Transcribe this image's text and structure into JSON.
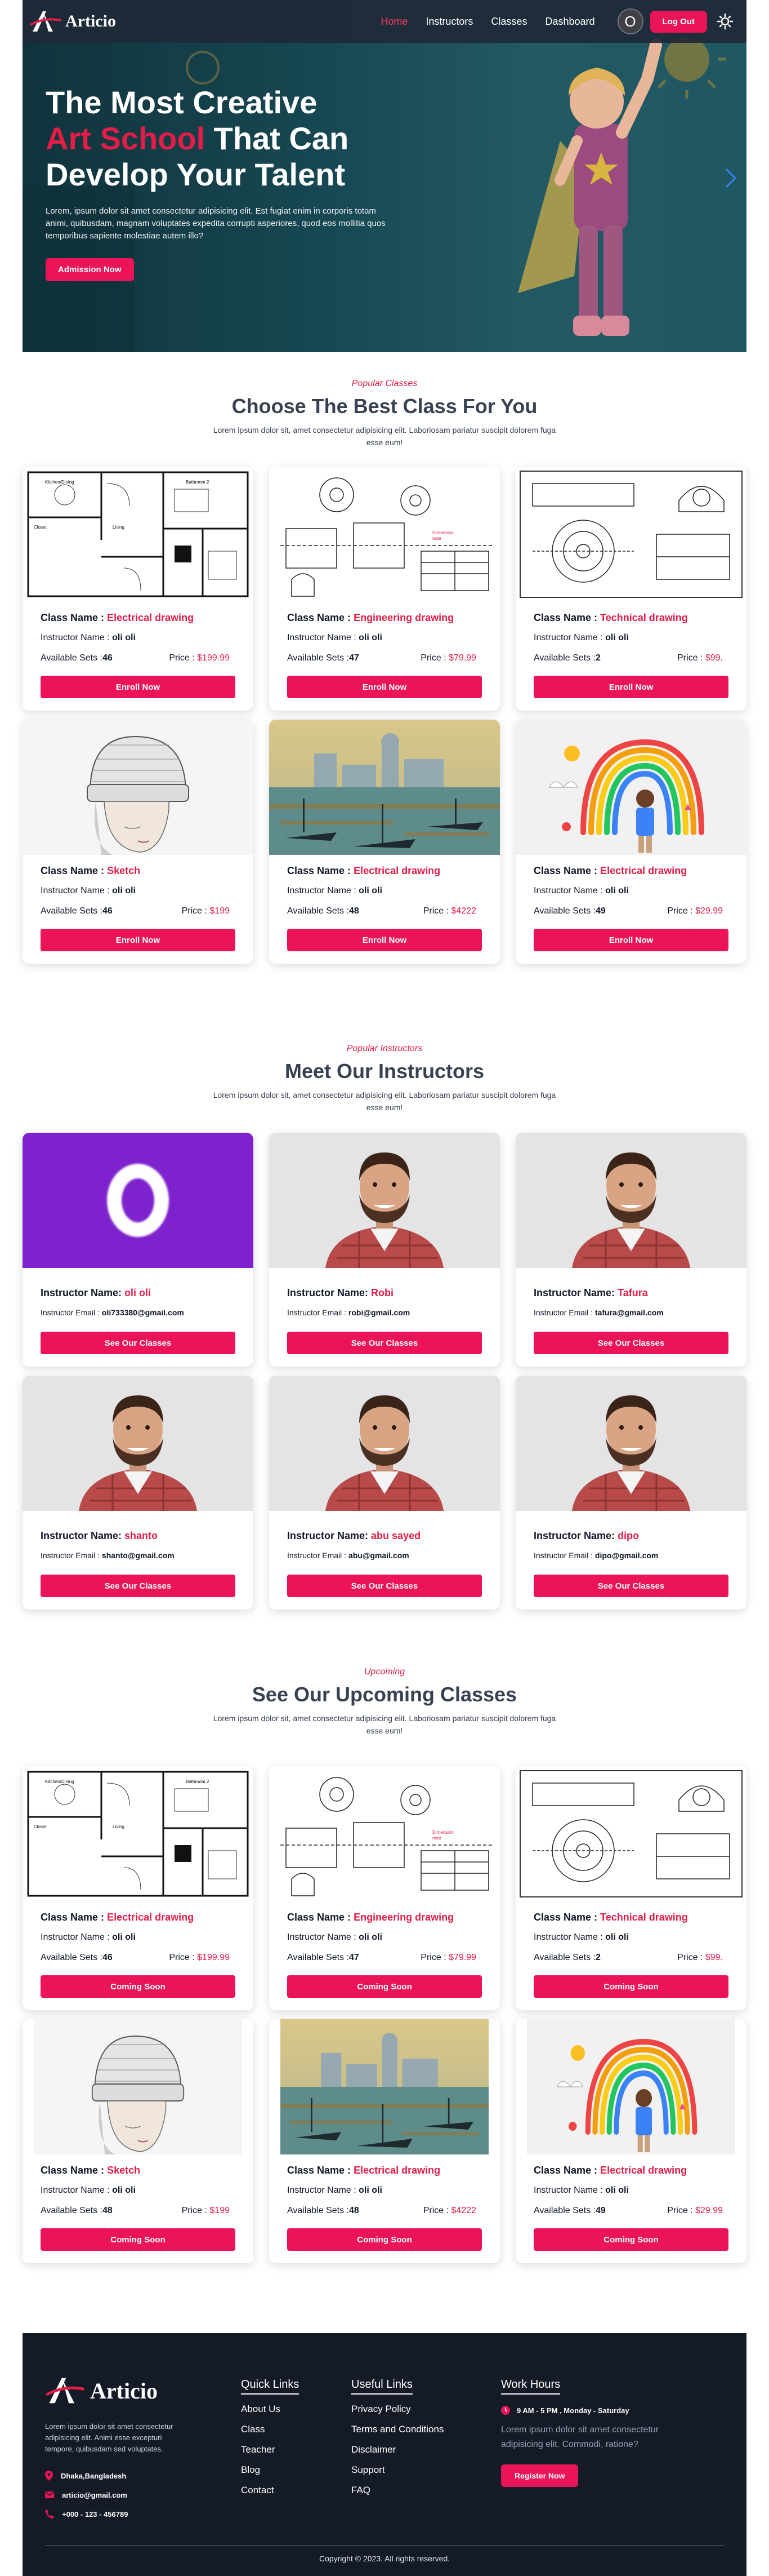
{
  "brand": {
    "name": "Articio"
  },
  "nav": {
    "links": [
      "Home",
      "Instructors",
      "Classes",
      "Dashboard"
    ],
    "avatar_letter": "O",
    "logout_label": "Log Out"
  },
  "hero": {
    "title_line1": "The Most Creative",
    "title_accent": "Art School",
    "title_line2_rest": " That Can",
    "title_line3": "Develop Your Talent",
    "description": "Lorem, ipsum dolor sit amet consectetur adipisicing elit. Est fugiat enim in corporis totam animi, quibusdam, magnam voluptates expedita corrupti asperiores, quod eos mollitia quos temporibus sapiente molestiae autem illo?",
    "button_label": "Admission Now"
  },
  "popular_classes": {
    "subtitle": "Popular Classes",
    "title": "Choose The Best Class For You",
    "description": "Lorem ipsum dolor sit, amet consectetur adipisicing elit. Laboriosam pariatur suscipit dolorem fuga esse eum!",
    "labels": {
      "class_name": "Class Name : ",
      "instructor_name": "Instructor Name : ",
      "available_sets": "Available Sets :",
      "price": "Price : "
    },
    "button_label": "Enroll Now",
    "items": [
      {
        "class_name": "Electrical drawing",
        "instructor": "oli oli",
        "sets": "46",
        "price": "$199.99",
        "image": "floor-plan"
      },
      {
        "class_name": "Engineering drawing",
        "instructor": "oli oli",
        "sets": "47",
        "price": "$79.99",
        "image": "engineering"
      },
      {
        "class_name": "Technical drawing",
        "instructor": "oli oli",
        "sets": "2",
        "price": "$99.",
        "image": "technical"
      },
      {
        "class_name": "Sketch",
        "instructor": "oli oli",
        "sets": "46",
        "price": "$199",
        "image": "sketch"
      },
      {
        "class_name": "Electrical drawing",
        "instructor": "oli oli",
        "sets": "48",
        "price": "$4222",
        "image": "painting"
      },
      {
        "class_name": "Electrical drawing",
        "instructor": "oli oli",
        "sets": "49",
        "price": "$29.99",
        "image": "rainbow"
      }
    ]
  },
  "instructors": {
    "subtitle": "Popular Instructors",
    "title": "Meet Our Instructors",
    "description": "Lorem ipsum dolor sit, amet consectetur adipisicing elit. Laboriosam pariatur suscipit dolorem fuga esse eum!",
    "labels": {
      "name": "Instructor Name: ",
      "email": "Instructor Email : "
    },
    "button_label": "See Our Classes",
    "items": [
      {
        "name": "oli oli",
        "email": "oli733380@gmail.com",
        "avatar": "letter",
        "letter": "O"
      },
      {
        "name": "Robi",
        "email": "robi@gmail.com",
        "avatar": "photo"
      },
      {
        "name": "Tafura",
        "email": "tafura@gmail.com",
        "avatar": "photo"
      },
      {
        "name": "shanto",
        "email": "shanto@gmail.com",
        "avatar": "photo"
      },
      {
        "name": "abu sayed",
        "email": "abu@gmail.com",
        "avatar": "photo"
      },
      {
        "name": "dipo",
        "email": "dipo@gmail.com",
        "avatar": "photo"
      }
    ]
  },
  "upcoming": {
    "subtitle": "Upcoming",
    "title": "See Our Upcoming Classes",
    "description": "Lorem ipsum dolor sit, amet consectetur adipisicing elit. Laboriosam pariatur suscipit dolorem fuga esse eum!",
    "button_label": "Coming Soon",
    "items": [
      {
        "class_name": "Electrical drawing",
        "instructor": "oli oli",
        "sets": "46",
        "price": "$199.99",
        "image": "floor-plan"
      },
      {
        "class_name": "Engineering drawing",
        "instructor": "oli oli",
        "sets": "47",
        "price": "$79.99",
        "image": "engineering"
      },
      {
        "class_name": "Technical drawing",
        "instructor": "oli oli",
        "sets": "2",
        "price": "$99.",
        "image": "technical"
      },
      {
        "class_name": "Sketch",
        "instructor": "oli oli",
        "sets": "48",
        "price": "$199",
        "image": "sketch"
      },
      {
        "class_name": "Electrical drawing",
        "instructor": "oli oli",
        "sets": "48",
        "price": "$4222",
        "image": "painting"
      },
      {
        "class_name": "Electrical drawing",
        "instructor": "oli oli",
        "sets": "49",
        "price": "$29.99",
        "image": "rainbow"
      }
    ]
  },
  "footer": {
    "about": "Lorem ipsum dolor sit amet consectetur adipisicing elit. Animi esse excepturi tempore, quibusdam sed voluptates.",
    "contact": {
      "location": "Dhaka,Bangladesh",
      "email": "articio@gmail.com",
      "phone": "+000 - 123 - 456789"
    },
    "quick_links": {
      "title": "Quick Links",
      "items": [
        "About Us",
        "Class",
        "Teacher",
        "Blog",
        "Contact"
      ]
    },
    "useful_links": {
      "title": "Useful Links",
      "items": [
        "Privacy Policy",
        "Terms and Conditions",
        "Disclaimer",
        "Support",
        "FAQ"
      ]
    },
    "work_hours": {
      "title": "Work Hours",
      "hours": "9 AM - 5 PM , Monday - Saturday",
      "text": "Lorem ipsum dolor sit amet consectetur adipisicing elit. Commodi, ratione?",
      "button_label": "Register Now"
    },
    "copyright": "Copyright © 2023. All rights reserved."
  },
  "colors": {
    "accent": "#ec1458",
    "accent_text": "#e11d48",
    "dark": "#141a26",
    "navbar": "#1f2937"
  }
}
